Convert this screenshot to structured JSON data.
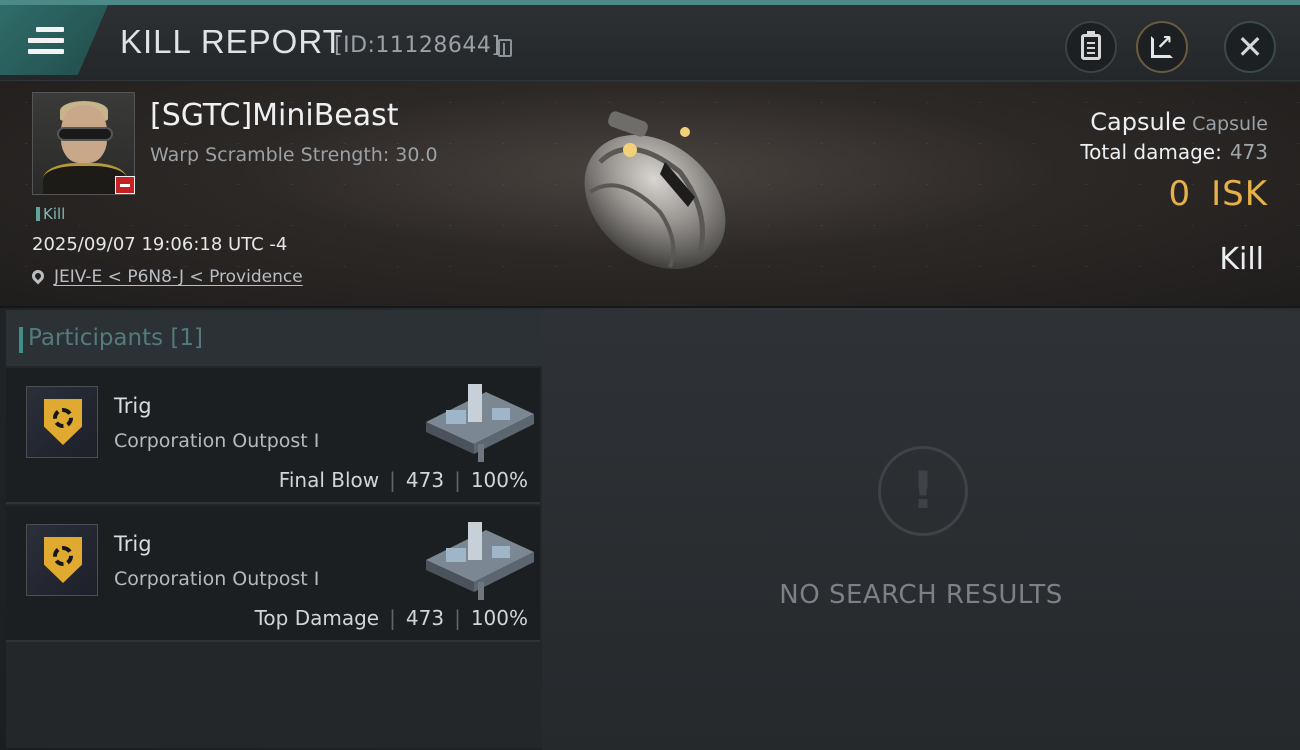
{
  "header": {
    "title": "KILL REPORT",
    "report_id": "[ID:11128644]",
    "icons": [
      "menu-icon",
      "copy-icon",
      "clipboard-icon",
      "share-icon",
      "close-icon"
    ]
  },
  "victim": {
    "name": "[SGTC]MiniBeast",
    "warp_scramble": "Warp Scramble Strength: 30.0",
    "tag": "Kill",
    "datetime": "2025/09/07 19:06:18 UTC -4",
    "location": "JEIV-E < P6N8-J < Providence",
    "ship_class": "Capsule",
    "ship_name": "Capsule",
    "total_damage_label": "Total damage:",
    "total_damage": "473",
    "isk_value": "0",
    "isk_unit": "ISK",
    "result": "Kill"
  },
  "participants": {
    "label": "Participants [1]",
    "rows": [
      {
        "name": "Trig",
        "ship": "Corporation Outpost I",
        "role": "Final Blow",
        "damage": "473",
        "percent": "100%"
      },
      {
        "name": "Trig",
        "ship": "Corporation Outpost I",
        "role": "Top Damage",
        "damage": "473",
        "percent": "100%"
      }
    ]
  },
  "results": {
    "empty_text": "NO SEARCH RESULTS"
  },
  "colors": {
    "accent": "#4b8a86",
    "isk": "#e6b04a",
    "corp_logo": "#e0a92f"
  }
}
